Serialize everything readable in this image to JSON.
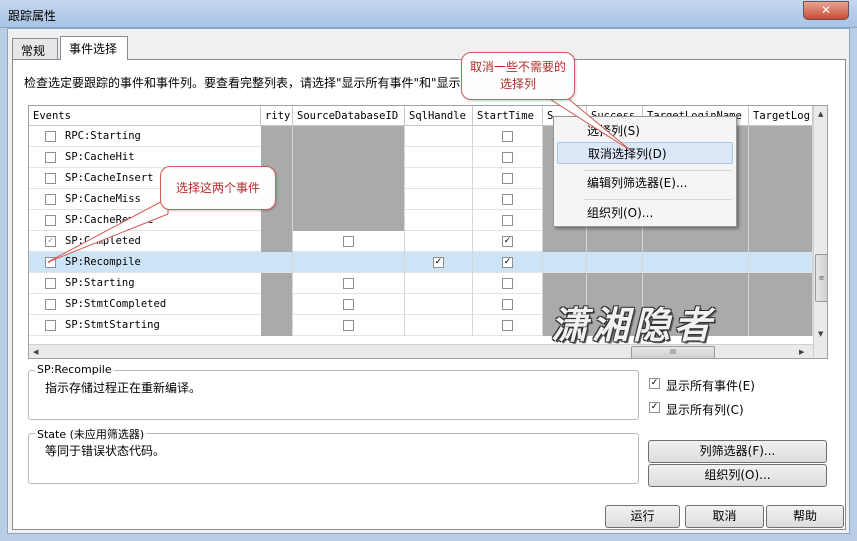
{
  "window": {
    "title": "跟踪属性",
    "close_glyph": "✕"
  },
  "tabs": [
    {
      "label": "常规"
    },
    {
      "label": "事件选择"
    }
  ],
  "instruction": "检查选定要跟踪的事件和事件列。要查看完整列表，请选择\"显示所有事件\"和\"显示",
  "grid": {
    "columns": [
      {
        "label": "Events"
      },
      {
        "label": "rity"
      },
      {
        "label": "SourceDatabaseID"
      },
      {
        "label": "SqlHandle"
      },
      {
        "label": "StartTime"
      },
      {
        "label": "S"
      },
      {
        "label": "Success"
      },
      {
        "label": "TargetLoginName"
      },
      {
        "label": "TargetLog:"
      }
    ],
    "rows": [
      {
        "label": "RPC:Starting",
        "checked": false,
        "selected": false
      },
      {
        "label": "SP:CacheHit",
        "checked": false,
        "selected": false
      },
      {
        "label": "SP:CacheInsert",
        "checked": false,
        "selected": false
      },
      {
        "label": "SP:CacheMiss",
        "checked": false,
        "selected": false
      },
      {
        "label": "SP:CacheRemove",
        "checked": false,
        "selected": false
      },
      {
        "label": "SP:Completed",
        "checked": true,
        "selected": false
      },
      {
        "label": "SP:Recompile",
        "checked": true,
        "selected": true
      },
      {
        "label": "SP:Starting",
        "checked": false,
        "selected": false
      },
      {
        "label": "SP:StmtCompleted",
        "checked": false,
        "selected": false
      },
      {
        "label": "SP:StmtStarting",
        "checked": false,
        "selected": false
      }
    ],
    "check_glyph": "✓",
    "hscroll_thumb": "III",
    "vscroll_thumb": "≡",
    "arrow_left": "◀",
    "arrow_right": "▶",
    "arrow_up": "▲",
    "arrow_down": "▼"
  },
  "context_menu": {
    "items": [
      {
        "label": "选择列(S)"
      },
      {
        "label": "取消选择列(D)"
      },
      {
        "label": "编辑列筛选器(E)..."
      },
      {
        "label": "组织列(O)..."
      }
    ]
  },
  "callouts": {
    "top": "取消一些不需要的选择列",
    "left": "选择这两个事件"
  },
  "watermark": "潇湘隐者",
  "description_group": {
    "title": "SP:Recompile",
    "text": "指示存储过程正在重新编译。"
  },
  "column_group": {
    "title": "State (未应用筛选器)",
    "text": "等同于错误状态代码。"
  },
  "options": {
    "show_all_events": "显示所有事件(E)",
    "show_all_columns": "显示所有列(C)"
  },
  "buttons": {
    "column_filters": "列筛选器(F)...",
    "organize_columns": "组织列(O)...",
    "run": "运行",
    "cancel": "取消",
    "help": "帮助"
  },
  "colors": {
    "accent_red": "#d15b55",
    "selection": "#cde4f7",
    "disabled_cell": "#aaaaaa"
  }
}
